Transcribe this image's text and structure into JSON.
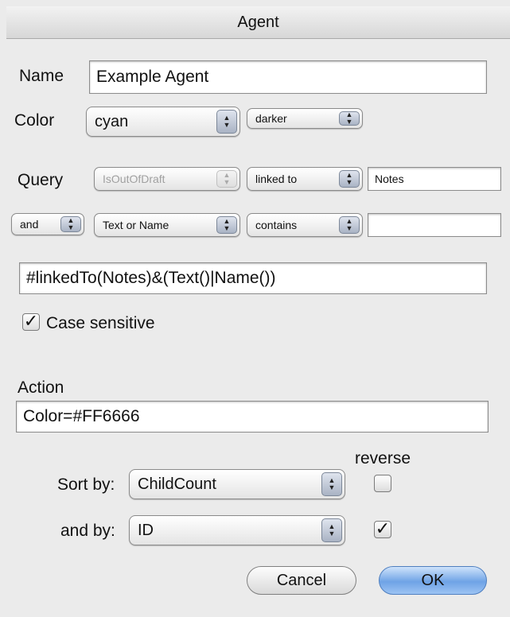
{
  "window": {
    "title": "Agent"
  },
  "name": {
    "label": "Name",
    "value": "Example Agent"
  },
  "color": {
    "label": "Color",
    "value": "cyan",
    "shade": "darker"
  },
  "query": {
    "label": "Query",
    "row1": {
      "attribute": "IsOutOfDraft",
      "operator": "linked to",
      "value": "Notes"
    },
    "row2": {
      "conjunction": "and",
      "attribute": "Text or Name",
      "operator": "contains",
      "value": ""
    },
    "expression": "#linkedTo(Notes)&(Text()|Name())"
  },
  "case_sensitive": {
    "label": "Case sensitive",
    "checked": true
  },
  "action": {
    "label": "Action",
    "value": "Color=#FF6666"
  },
  "sort": {
    "reverse_label": "reverse",
    "sort_by_label": "Sort by:",
    "sort_by_value": "ChildCount",
    "sort_by_reverse": false,
    "and_by_label": "and by:",
    "and_by_value": "ID",
    "and_by_reverse": true
  },
  "buttons": {
    "cancel": "Cancel",
    "ok": "OK"
  },
  "icons": {
    "popup": "popup-arrows-icon",
    "check": "checkmark-icon"
  }
}
